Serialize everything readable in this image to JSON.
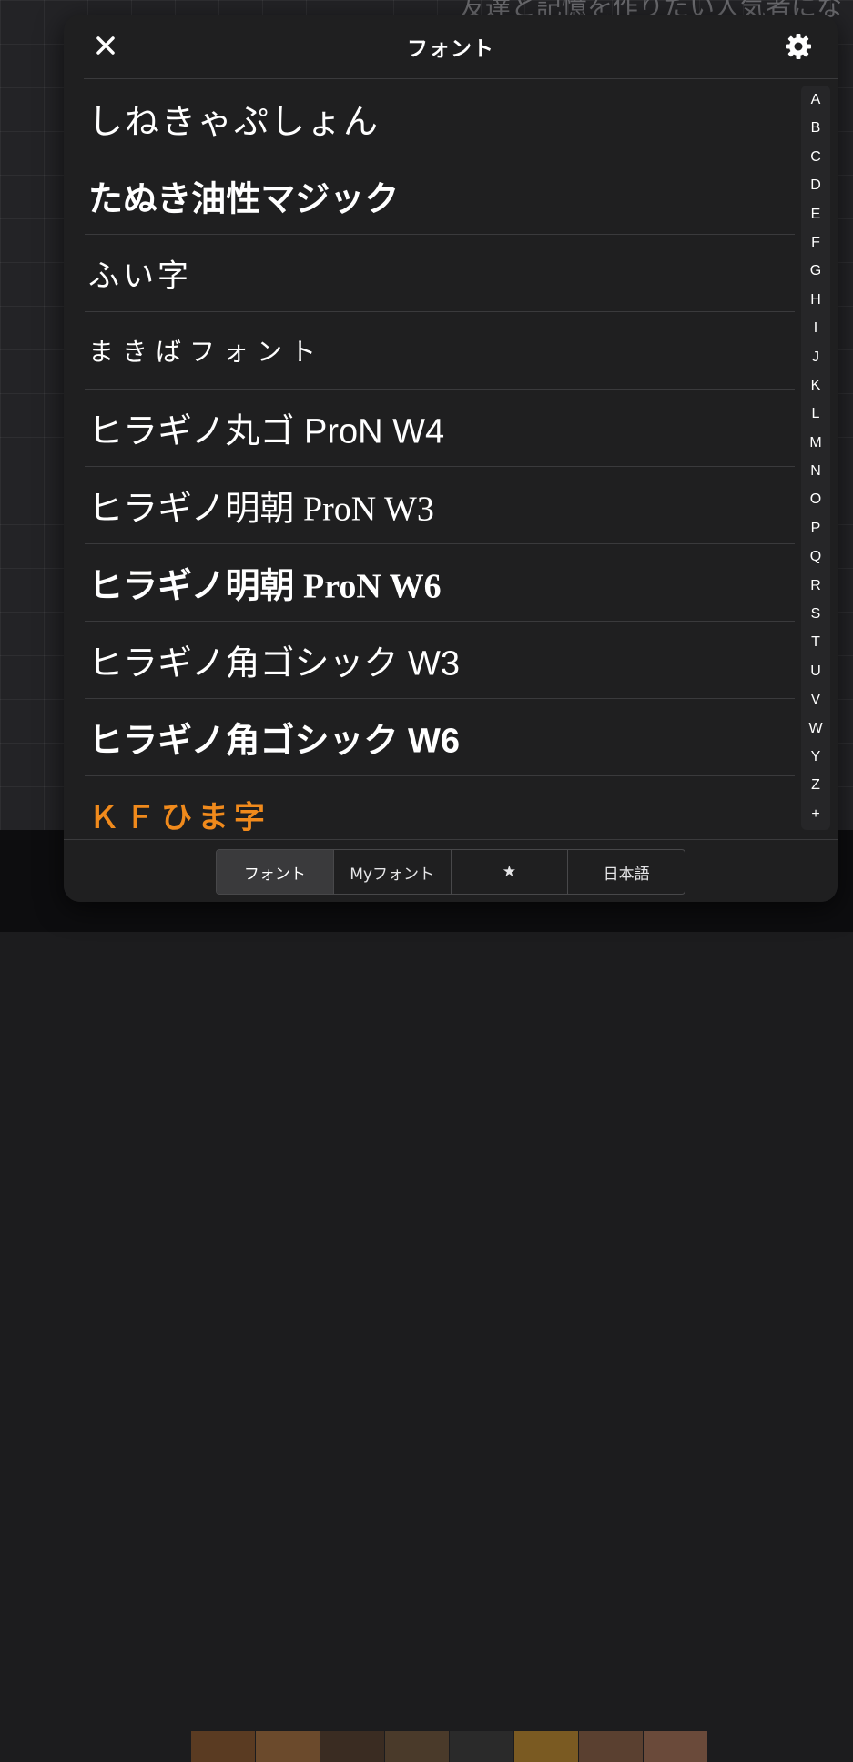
{
  "background": {
    "top_text": "友達と記憶を作りたい人気者にな"
  },
  "header": {
    "title": "フォント",
    "close_icon": "close-icon",
    "settings_icon": "gear-icon"
  },
  "fonts": [
    {
      "label": "しねきゃぷしょん"
    },
    {
      "label": "たぬき油性マジック"
    },
    {
      "label": "ふい字"
    },
    {
      "label": "まきばフォント"
    },
    {
      "label": "ヒラギノ丸ゴ ProN W4"
    },
    {
      "label": "ヒラギノ明朝 ProN W3"
    },
    {
      "label": "ヒラギノ明朝 ProN W6"
    },
    {
      "label": "ヒラギノ角ゴシック W3"
    },
    {
      "label": "ヒラギノ角ゴシック W6"
    },
    {
      "label": "ＫＦひま字",
      "color": "#f08a1c"
    }
  ],
  "index": [
    "A",
    "B",
    "C",
    "D",
    "E",
    "F",
    "G",
    "H",
    "I",
    "J",
    "K",
    "L",
    "M",
    "N",
    "O",
    "P",
    "Q",
    "R",
    "S",
    "T",
    "U",
    "V",
    "W",
    "Y",
    "Z",
    "+"
  ],
  "tabs": [
    {
      "label": "フォント",
      "active": true
    },
    {
      "label": "Myフォント",
      "active": false
    },
    {
      "label": "★",
      "active": false
    },
    {
      "label": "日本語",
      "active": false
    }
  ],
  "colors": {
    "panel_bg": "#1f1f20",
    "divider": "#3a3a3c",
    "accent_orange": "#f08a1c",
    "text": "#ffffff"
  }
}
